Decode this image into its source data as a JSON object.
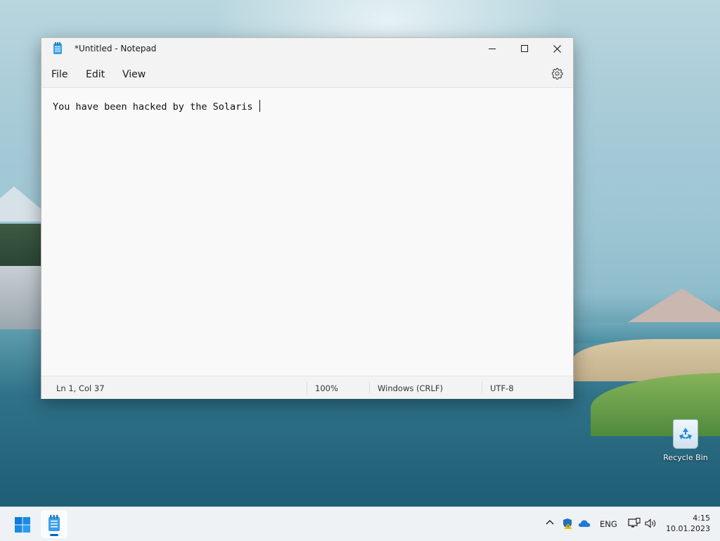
{
  "window": {
    "title": "*Untitled - Notepad",
    "menu": {
      "file": "File",
      "edit": "Edit",
      "view": "View"
    },
    "editor_text": "You have been hacked by the Solaris ",
    "status": {
      "position": "Ln 1, Col 37",
      "zoom": "100%",
      "line_endings": "Windows (CRLF)",
      "encoding": "UTF-8"
    }
  },
  "desktop": {
    "icons": [
      {
        "label": "Recycle Bin",
        "icon": "recycle-bin-icon"
      }
    ]
  },
  "taskbar": {
    "language": "ENG",
    "time": "4:15",
    "date": "10.01.2023",
    "pinned": [
      {
        "icon": "notepad-icon",
        "active": true
      }
    ]
  },
  "colors": {
    "accent": "#0067c0",
    "window_bg": "#f9f9f9",
    "titlebar_bg": "#f3f3f3"
  }
}
